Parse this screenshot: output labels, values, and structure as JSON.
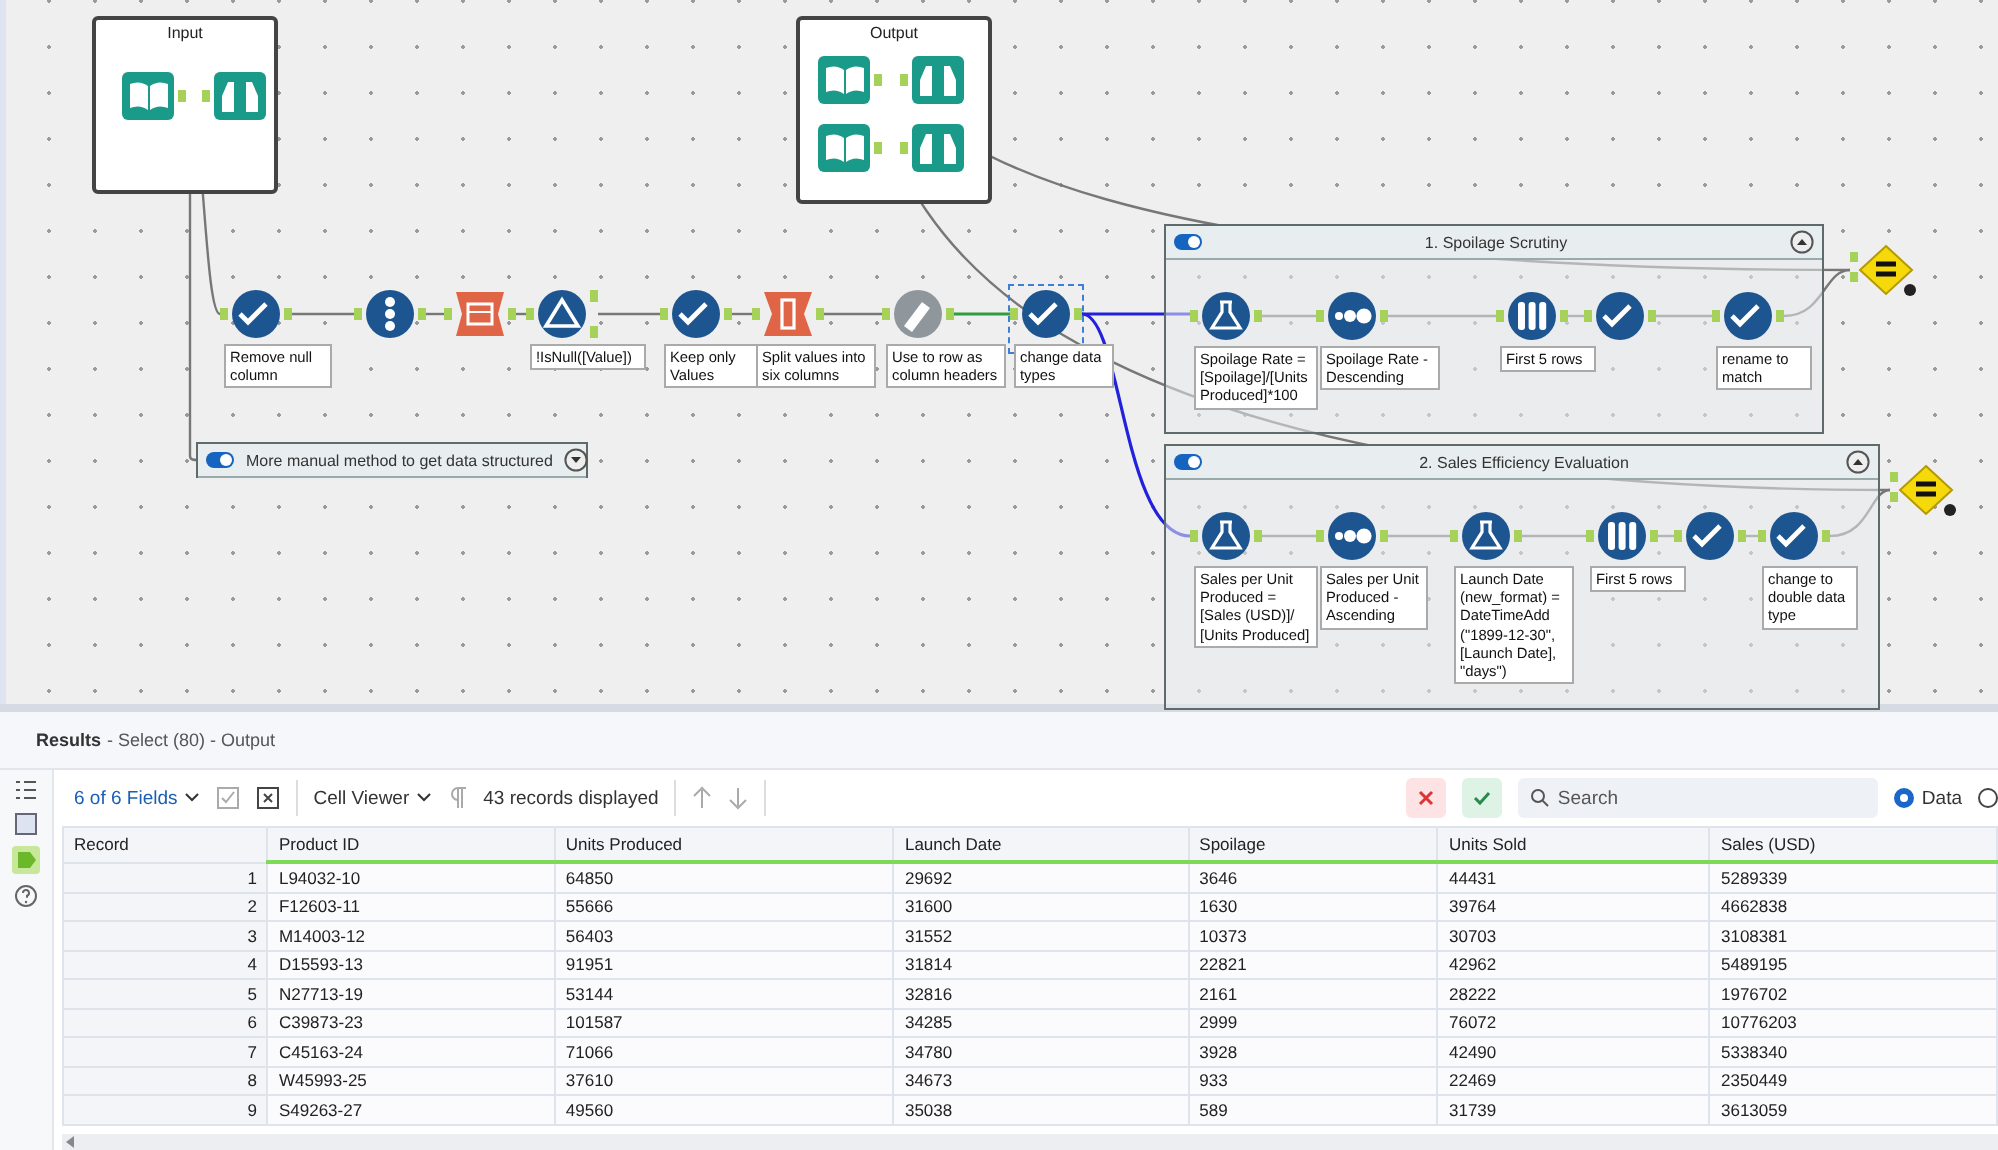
{
  "canvas": {
    "containers": [
      {
        "kind": "plain",
        "title": "Input"
      },
      {
        "kind": "plain",
        "title": "Output"
      },
      {
        "kind": "toggle",
        "title": "1. Spoilage Scrutiny",
        "on": true,
        "expanded": true
      },
      {
        "kind": "toggle",
        "title": "More manual method to get data structured",
        "on": true,
        "expanded": false
      },
      {
        "kind": "toggle",
        "title": "2. Sales Efficiency Evaluation",
        "on": true,
        "expanded": true
      }
    ],
    "tools": [
      {
        "kind": "input",
        "selected": false
      },
      {
        "kind": "browse",
        "selected": false
      },
      {
        "kind": "input",
        "selected": false
      },
      {
        "kind": "browse",
        "selected": false
      },
      {
        "kind": "input",
        "selected": false
      },
      {
        "kind": "browse",
        "selected": false
      },
      {
        "kind": "select",
        "label": "Remove null column",
        "selected": false
      },
      {
        "kind": "recordid",
        "selected": false
      },
      {
        "kind": "transpose",
        "selected": false
      },
      {
        "kind": "filter",
        "label": "!IsNull([Value])",
        "selected": false
      },
      {
        "kind": "select",
        "label": "Keep only Values",
        "selected": false
      },
      {
        "kind": "textcols",
        "label": "Split values into six columns",
        "selected": false
      },
      {
        "kind": "rename",
        "label": "Use to row as column headers",
        "selected": false
      },
      {
        "kind": "select",
        "label": "change data types",
        "selected": true
      },
      {
        "kind": "formula",
        "label": "Spoilage Rate = [Spoilage]/[Units Produced]*100",
        "selected": false
      },
      {
        "kind": "sort",
        "label": "Spoilage Rate - Descending",
        "selected": false
      },
      {
        "kind": "sample",
        "label": "First 5 rows",
        "selected": false
      },
      {
        "kind": "select",
        "selected": false
      },
      {
        "kind": "select",
        "label": "rename to match",
        "selected": false
      },
      {
        "kind": "formula",
        "label": "Sales per Unit Produced = [Sales (USD)]/ [Units Produced]",
        "selected": false
      },
      {
        "kind": "sort",
        "label": "Sales per Unit Produced - Ascending",
        "selected": false
      },
      {
        "kind": "formula",
        "label": "Launch Date (new_format) = DateTimeAdd (\"1899-12-30\", [Launch Date], \"days\")",
        "selected": false
      },
      {
        "kind": "sample",
        "label": "First 5 rows",
        "selected": false
      },
      {
        "kind": "select",
        "selected": false
      },
      {
        "kind": "select",
        "label": "change to double data type",
        "selected": false
      },
      {
        "kind": "union",
        "selected": false
      },
      {
        "kind": "union",
        "selected": false
      }
    ]
  },
  "results": {
    "title": "Results",
    "subtitle": "- Select (80) - Output",
    "fields": "6 of 6 Fields",
    "viewer": "Cell Viewer",
    "records": "43 records displayed",
    "search": {
      "placeholder": "Search"
    },
    "views": [
      {
        "label": "Data",
        "selected": true
      },
      {
        "selected": false
      }
    ],
    "table": {
      "columns": [
        "Record",
        "Product ID",
        "Units Produced",
        "Launch Date",
        "Spoilage",
        "Units Sold",
        "Sales (USD)"
      ],
      "rows": [
        [
          "1",
          "L94032-10",
          "64850",
          "29692",
          "3646",
          "44431",
          "5289339"
        ],
        [
          "2",
          "F12603-11",
          "55666",
          "31600",
          "1630",
          "39764",
          "4662838"
        ],
        [
          "3",
          "M14003-12",
          "56403",
          "31552",
          "10373",
          "30703",
          "3108381"
        ],
        [
          "4",
          "D15593-13",
          "91951",
          "31814",
          "22821",
          "42962",
          "5489195"
        ],
        [
          "5",
          "N27713-19",
          "53144",
          "32816",
          "2161",
          "28222",
          "1976702"
        ],
        [
          "6",
          "C39873-23",
          "101587",
          "34285",
          "2999",
          "76072",
          "10776203"
        ],
        [
          "7",
          "C45163-24",
          "71066",
          "34780",
          "3928",
          "42490",
          "5338340"
        ],
        [
          "8",
          "W45993-25",
          "37610",
          "34673",
          "933",
          "22469",
          "2350449"
        ],
        [
          "9",
          "S49263-27",
          "49560",
          "35038",
          "589",
          "31739",
          "3613059"
        ]
      ]
    }
  }
}
